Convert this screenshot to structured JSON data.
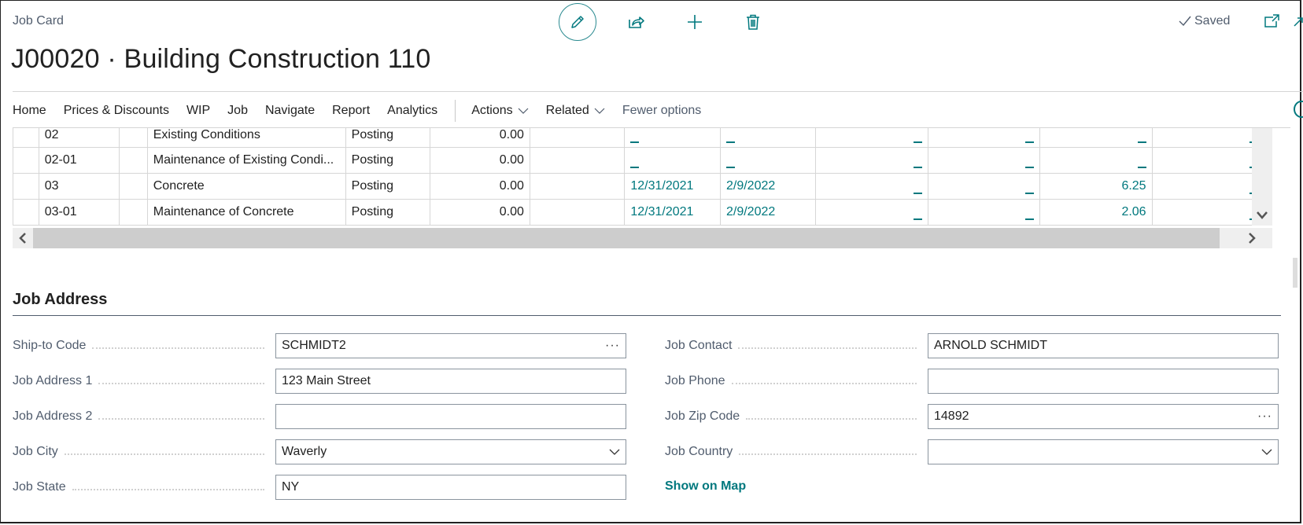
{
  "header": {
    "breadcrumb": "Job Card",
    "title": "J00020 · Building Construction 110",
    "status": "Saved",
    "actions": [
      {
        "name": "edit",
        "icon": "pencil-icon"
      },
      {
        "name": "share",
        "icon": "share-icon"
      },
      {
        "name": "new",
        "icon": "plus-icon"
      },
      {
        "name": "delete",
        "icon": "trash-icon"
      }
    ]
  },
  "nav": {
    "items": [
      "Home",
      "Prices & Discounts",
      "WIP",
      "Job",
      "Navigate",
      "Report",
      "Analytics"
    ],
    "dropdowns": [
      "Actions",
      "Related"
    ],
    "fewer_options": "Fewer options"
  },
  "grid": {
    "rows": [
      {
        "no": "02",
        "description": "Existing Conditions",
        "type": "Posting",
        "amount": "0.00",
        "start_date": "_",
        "end_date": "_",
        "c1": "_",
        "c2": "_",
        "c3": "_",
        "c4": "_"
      },
      {
        "no": "02-01",
        "description": "Maintenance of Existing Condi...",
        "type": "Posting",
        "amount": "0.00",
        "start_date": "_",
        "end_date": "_",
        "c1": "_",
        "c2": "_",
        "c3": "_",
        "c4": "_"
      },
      {
        "no": "03",
        "description": "Concrete",
        "type": "Posting",
        "amount": "0.00",
        "start_date": "12/31/2021",
        "end_date": "2/9/2022",
        "c1": "_",
        "c2": "_",
        "c3": "6.25",
        "c4": "_"
      },
      {
        "no": "03-01",
        "description": "Maintenance of Concrete",
        "type": "Posting",
        "amount": "0.00",
        "start_date": "12/31/2021",
        "end_date": "2/9/2022",
        "c1": "_",
        "c2": "_",
        "c3": "2.06",
        "c4": "_"
      }
    ]
  },
  "job_address": {
    "title": "Job Address",
    "left": [
      {
        "label": "Ship-to Code",
        "value": "SCHMIDT2",
        "control": "lookup"
      },
      {
        "label": "Job Address 1",
        "value": "123 Main Street",
        "control": "text"
      },
      {
        "label": "Job Address 2",
        "value": "",
        "control": "text"
      },
      {
        "label": "Job City",
        "value": "Waverly",
        "control": "dropdown"
      },
      {
        "label": "Job State",
        "value": "NY",
        "control": "text"
      }
    ],
    "right": [
      {
        "label": "Job Contact",
        "value": "ARNOLD SCHMIDT",
        "control": "text"
      },
      {
        "label": "Job Phone",
        "value": "",
        "control": "text"
      },
      {
        "label": "Job Zip Code",
        "value": "14892",
        "control": "lookup"
      },
      {
        "label": "Job Country",
        "value": "",
        "control": "dropdown"
      }
    ],
    "show_on_map": "Show on Map"
  },
  "colors": {
    "accent": "#00787e",
    "label": "#505c6d"
  }
}
